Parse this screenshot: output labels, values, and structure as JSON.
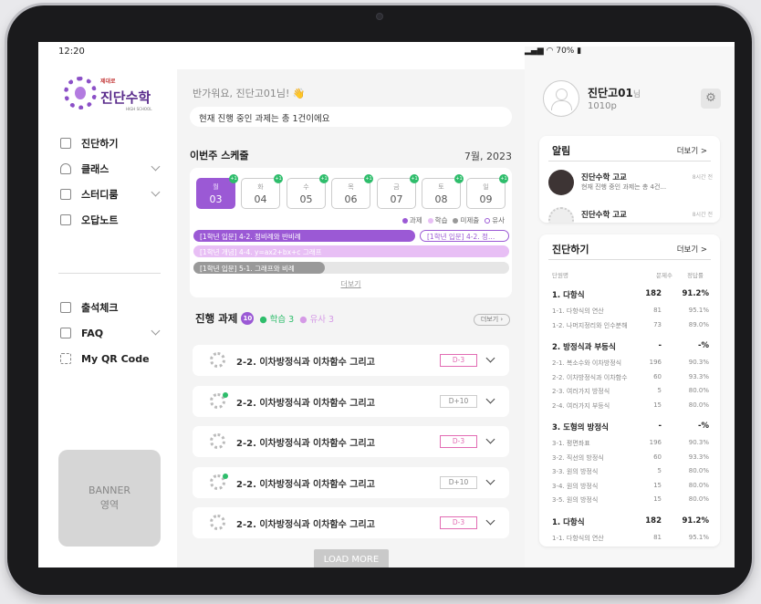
{
  "status": {
    "time": "12:20",
    "battery": "70%"
  },
  "sidebar": {
    "logo": {
      "tiny": "제대로",
      "name": "진단수학",
      "sub": "HIGH SCHOOL"
    },
    "items": [
      {
        "label": "진단하기"
      },
      {
        "label": "클래스"
      },
      {
        "label": "스터디룸"
      },
      {
        "label": "오답노트"
      },
      {
        "label": "출석체크"
      },
      {
        "label": "FAQ"
      },
      {
        "label": "My QR Code"
      }
    ],
    "banner": {
      "line1": "BANNER",
      "line2": "영역"
    }
  },
  "main": {
    "greeting": "반가워요, 진단고01님! 👋",
    "notice": "현재 진행 중인 과제는 총 1건이에요",
    "schedule": {
      "title": "이번주 스케줄",
      "date": "7월, 2023",
      "days": [
        {
          "dow": "월",
          "num": "03",
          "badge": "+1"
        },
        {
          "dow": "화",
          "num": "04",
          "badge": "+1"
        },
        {
          "dow": "수",
          "num": "05",
          "badge": "+1"
        },
        {
          "dow": "목",
          "num": "06",
          "badge": "+1"
        },
        {
          "dow": "금",
          "num": "07",
          "badge": "+1"
        },
        {
          "dow": "토",
          "num": "08",
          "badge": "+1"
        },
        {
          "dow": "일",
          "num": "09",
          "badge": "+1"
        }
      ],
      "legend": [
        "과제",
        "학습",
        "미제출",
        "유사"
      ],
      "bars": [
        "[1학년 입문] 4-2. 정비례와 반비례",
        "[1학년 입문] 4-2. 정…",
        "[1학년 개념] 4-4. y=ax2+bx+c 그래프",
        "[1학년 입문] 5-1. 그래프와 비례"
      ],
      "more": "더보기"
    },
    "tasks": {
      "title": "진행 과제",
      "count": "10",
      "study": "● 학습 3",
      "similar": "● 유사 3",
      "more": "더보기",
      "rows": [
        {
          "label": "2-2. 이차방정식과 이차함수 그리고",
          "tag": "D-3"
        },
        {
          "label": "2-2. 이차방정식과 이차함수 그리고",
          "tag": "D+10"
        },
        {
          "label": "2-2. 이차방정식과 이차함수 그리고",
          "tag": "D-3"
        },
        {
          "label": "2-2. 이차방정식과 이차함수 그리고",
          "tag": "D+10"
        },
        {
          "label": "2-2. 이차방정식과 이차함수 그리고",
          "tag": "D-3"
        }
      ],
      "loadmore": "LOAD MORE"
    }
  },
  "right": {
    "user": {
      "name": "진단고01",
      "suffix": "님",
      "points": "1010p"
    },
    "alerts": {
      "title": "알림",
      "more": "더보기 >",
      "items": [
        {
          "title": "진단수학 고교",
          "desc": "현재 진행 중인 과제는 총 4건...",
          "time": "8시간 전"
        },
        {
          "title": "진단수학 고교",
          "desc": "",
          "time": "8시간 전"
        }
      ]
    },
    "diag": {
      "title": "진단하기",
      "more": "더보기 >",
      "cols": [
        "단원명",
        "문제수",
        "정답률"
      ],
      "rows": [
        {
          "name": "1. 다항식",
          "n": "182",
          "rate": "91.2%",
          "head": true
        },
        {
          "name": "1-1. 다항식의 연산",
          "n": "81",
          "rate": "95.1%"
        },
        {
          "name": "1-2. 나머지정리와 인수분해",
          "n": "73",
          "rate": "89.0%"
        },
        {
          "name": "2. 방정식과 부등식",
          "n": "-",
          "rate": "-%",
          "head": true
        },
        {
          "name": "2-1. 복소수와 이차방정식",
          "n": "196",
          "rate": "90.3%"
        },
        {
          "name": "2-2. 이차방정식과 이차함수",
          "n": "60",
          "rate": "93.3%"
        },
        {
          "name": "2-3. 여러가지 방정식",
          "n": "5",
          "rate": "80.0%"
        },
        {
          "name": "2-4. 여러가지 부등식",
          "n": "15",
          "rate": "80.0%"
        },
        {
          "name": "3. 도형의 방정식",
          "n": "-",
          "rate": "-%",
          "head": true
        },
        {
          "name": "3-1. 평면좌표",
          "n": "196",
          "rate": "90.3%"
        },
        {
          "name": "3-2. 직선의 방정식",
          "n": "60",
          "rate": "93.3%"
        },
        {
          "name": "3-3. 원의 방정식",
          "n": "5",
          "rate": "80.0%"
        },
        {
          "name": "3-4. 원의 방정식",
          "n": "15",
          "rate": "80.0%"
        },
        {
          "name": "3-5. 원의 방정식",
          "n": "15",
          "rate": "80.0%"
        },
        {
          "name": "1. 다항식",
          "n": "182",
          "rate": "91.2%",
          "head": true
        },
        {
          "name": "1-1. 다항식의 연산",
          "n": "81",
          "rate": "95.1%"
        }
      ]
    }
  },
  "colors": {
    "accent": "#9b59d5",
    "green": "#2ebd6b",
    "pink": "#e26bb3",
    "lightPurple": "#e8bff5"
  }
}
